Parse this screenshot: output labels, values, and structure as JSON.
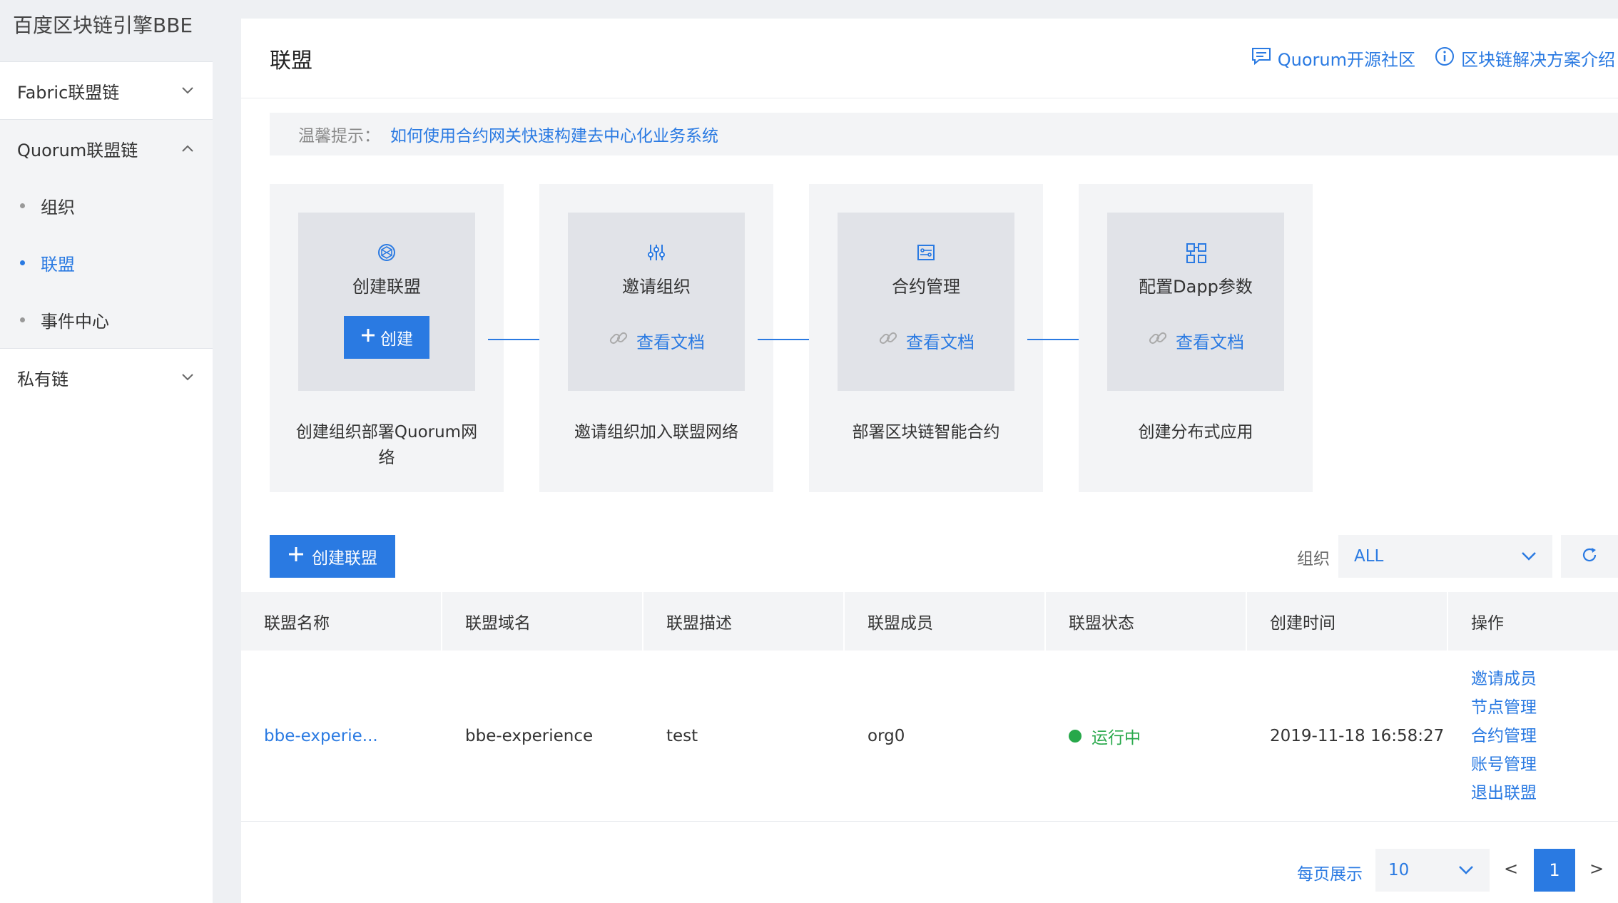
{
  "sidebar": {
    "brand": "百度区块链引擎BBE",
    "groups": [
      {
        "label": "Fabric联盟链"
      },
      {
        "label": "Quorum联盟链",
        "items": [
          {
            "label": "组织"
          },
          {
            "label": "联盟"
          },
          {
            "label": "事件中心"
          }
        ]
      },
      {
        "label": "私有链"
      }
    ]
  },
  "header": {
    "title": "联盟",
    "links": [
      {
        "label": "Quorum开源社区",
        "icon": "chat-icon"
      },
      {
        "label": "区块链解决方案介绍",
        "icon": "info-icon"
      }
    ]
  },
  "tip": {
    "label": "温馨提示：",
    "link": "如何使用合约网关快速构建去中心化业务系统"
  },
  "steps": [
    {
      "name": "创建联盟",
      "icon": "network-icon",
      "action": "创建",
      "desc": "创建组织部署Quorum网络"
    },
    {
      "name": "邀请组织",
      "icon": "sliders-icon",
      "action": "查看文档",
      "desc": "邀请组织加入联盟网络"
    },
    {
      "name": "合约管理",
      "icon": "contract-icon",
      "action": "查看文档",
      "desc": "部署区块链智能合约"
    },
    {
      "name": "配置Dapp参数",
      "icon": "modules-icon",
      "action": "查看文档",
      "desc": "创建分布式应用"
    }
  ],
  "toolbar": {
    "create_label": "创建联盟",
    "filter_label": "组织",
    "filter_value": "ALL"
  },
  "table": {
    "columns": [
      "联盟名称",
      "联盟域名",
      "联盟描述",
      "联盟成员",
      "联盟状态",
      "创建时间",
      "操作"
    ],
    "rows": [
      {
        "name": "bbe-experie...",
        "domain": "bbe-experience",
        "desc": "test",
        "members": "org0",
        "status": "运行中",
        "created": "2019-11-18 16:58:27",
        "ops": [
          "邀请成员",
          "节点管理",
          "合约管理",
          "账号管理",
          "退出联盟"
        ]
      }
    ]
  },
  "pagination": {
    "per_page_label": "每页展示",
    "per_page": "10",
    "prev": "<",
    "page": "1",
    "next": ">"
  },
  "colors": {
    "accent": "#2a7ae2",
    "running": "#27a84a"
  }
}
